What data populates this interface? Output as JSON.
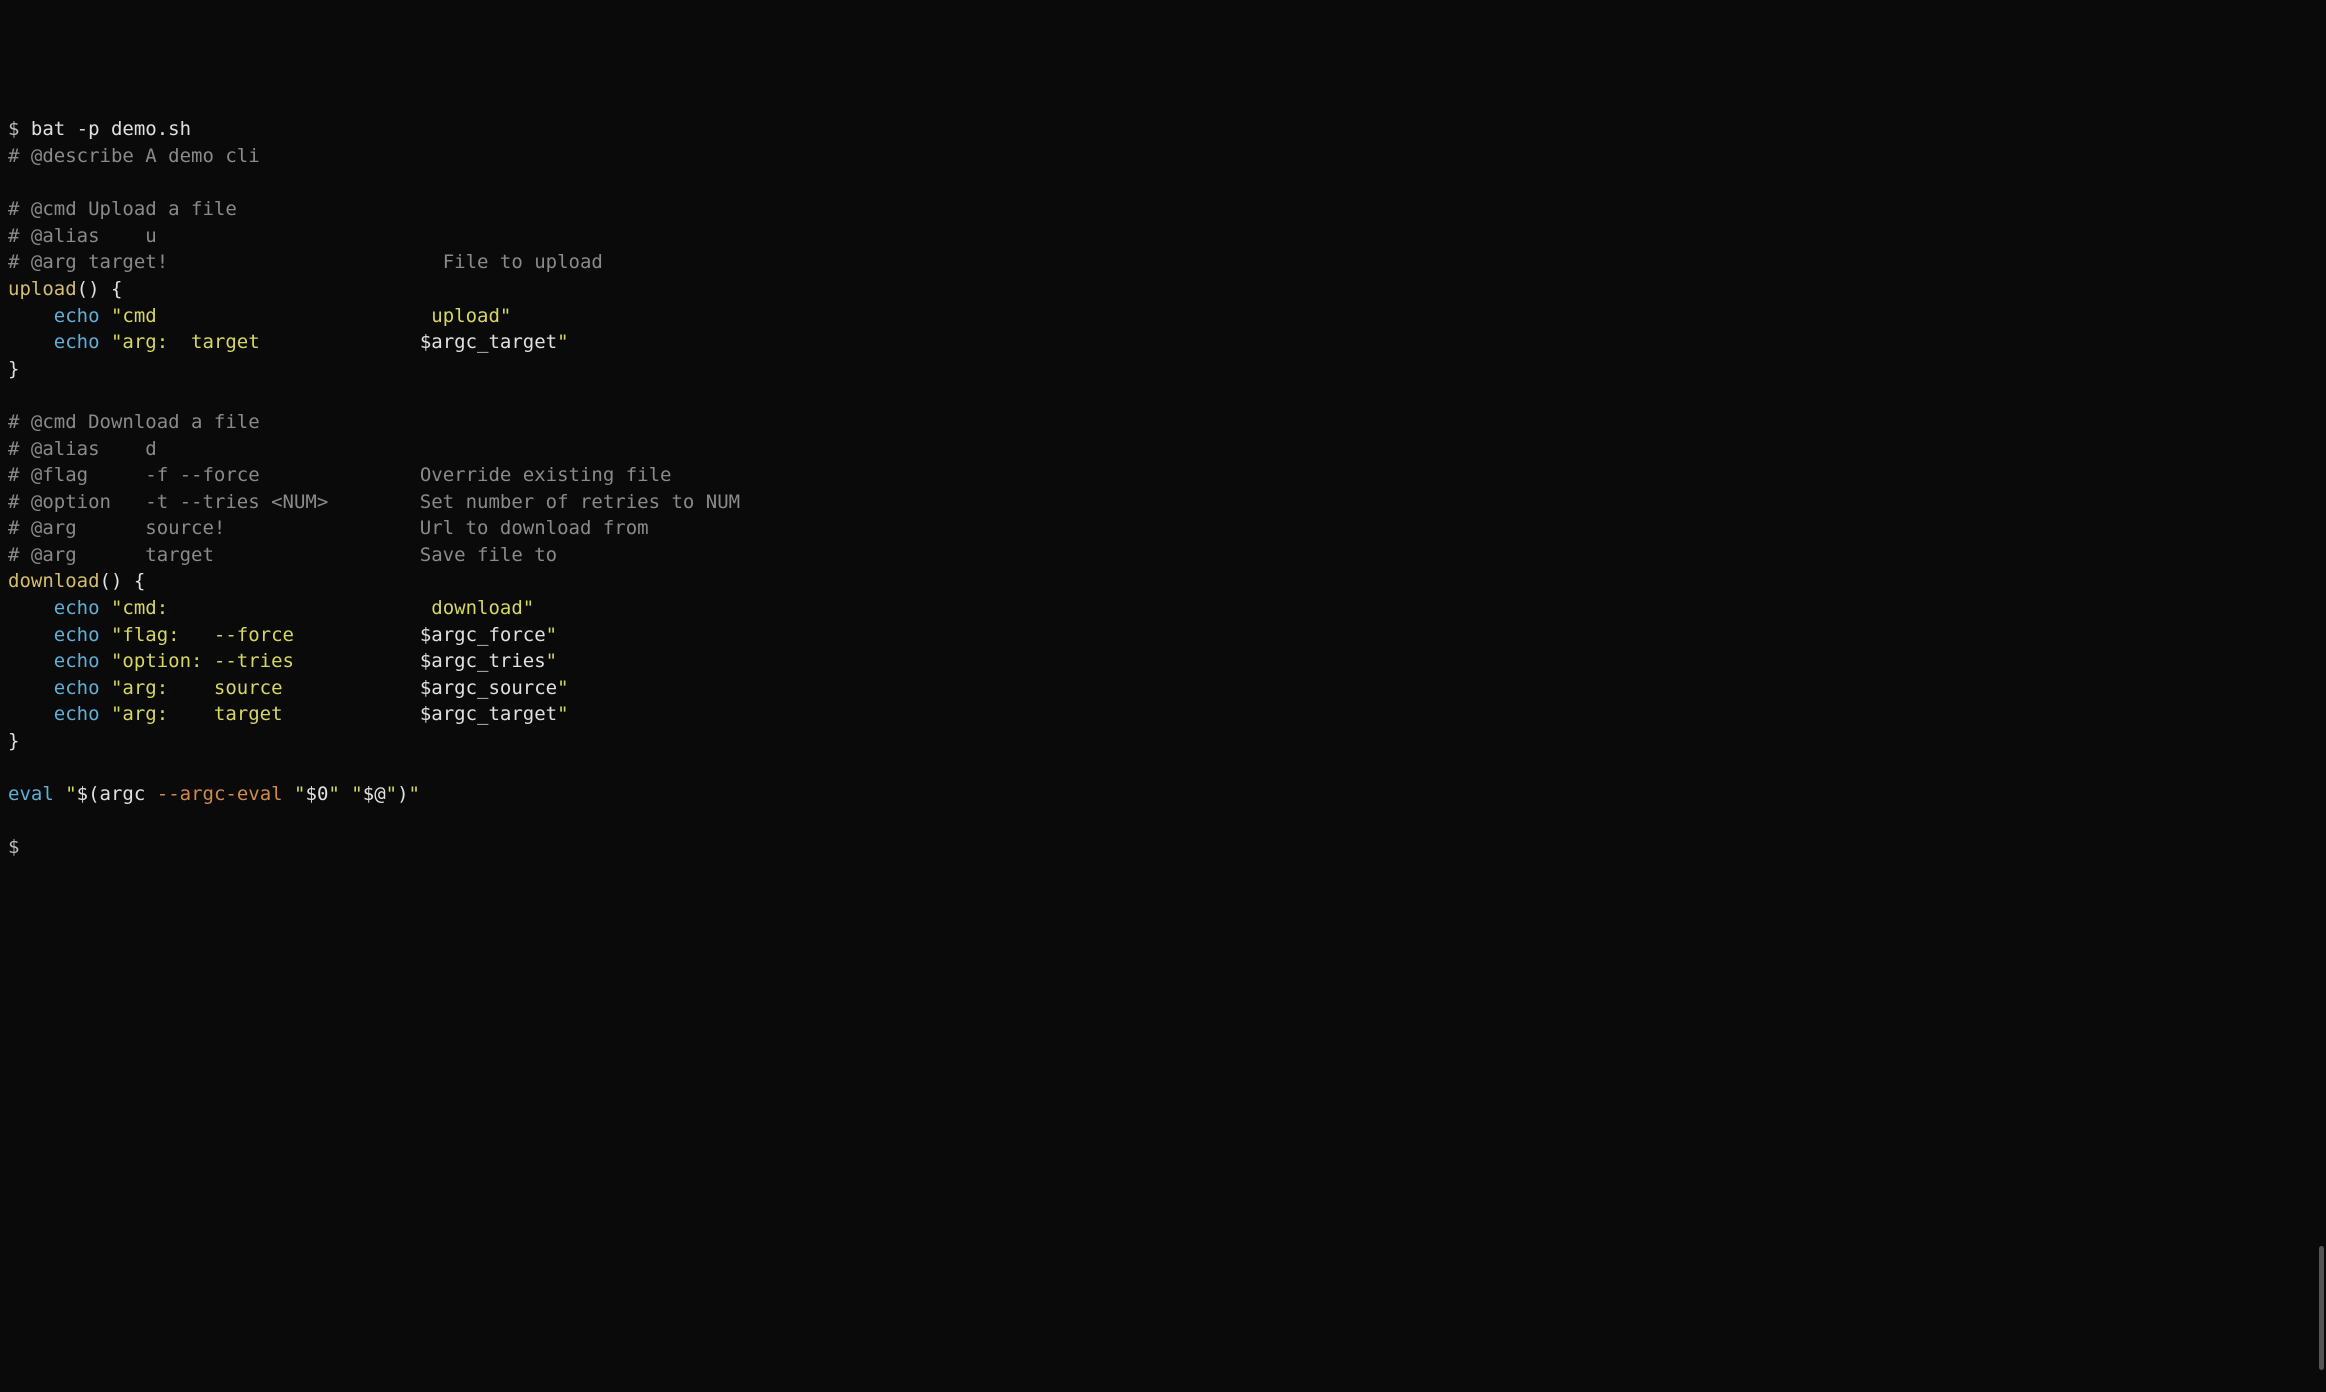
{
  "terminal": {
    "prompt1_symbol": "$ ",
    "prompt1_command": "bat -p demo.sh",
    "prompt2_symbol": "$",
    "file_content": {
      "comment_describe": "# @describe A demo cli",
      "comment_cmd_upload": "# @cmd Upload a file",
      "comment_alias_u": "# @alias    u",
      "comment_arg_target_upload_prefix": "# @arg target!",
      "comment_arg_target_upload_desc": "                        File to upload",
      "upload_func_name": "upload",
      "upload_paren": "()",
      "upload_open_brace": " {",
      "echo_kw": "echo",
      "upload_echo1_str": " \"cmd                        upload\"",
      "upload_echo2_str_part1": " \"arg:  target              ",
      "upload_echo2_var": "$argc_target",
      "upload_echo2_str_part2": "\"",
      "close_brace": "}",
      "comment_cmd_download": "# @cmd Download a file",
      "comment_alias_d": "# @alias    d",
      "comment_flag_force_prefix": "# @flag     -f --force",
      "comment_flag_force_desc": "              Override existing file",
      "comment_option_tries_prefix": "# @option   -t --tries <NUM>",
      "comment_option_tries_desc": "        Set number of retries to NUM",
      "comment_arg_source_prefix": "# @arg      source!",
      "comment_arg_source_desc": "                 Url to download from",
      "comment_arg_target_download_prefix": "# @arg      target",
      "comment_arg_target_download_desc": "                  Save file to",
      "download_func_name": "download",
      "download_paren": "()",
      "download_open_brace": " {",
      "download_echo1_str": " \"cmd:                       download\"",
      "download_echo2_str_part1": " \"flag:   --force           ",
      "download_echo2_var": "$argc_force",
      "download_echo2_str_part2": "\"",
      "download_echo3_str_part1": " \"option: --tries           ",
      "download_echo3_var": "$argc_tries",
      "download_echo3_str_part2": "\"",
      "download_echo4_str_part1": " \"arg:    source            ",
      "download_echo4_var": "$argc_source",
      "download_echo4_str_part2": "\"",
      "download_echo5_str_part1": " \"arg:    target            ",
      "download_echo5_var": "$argc_target",
      "download_echo5_str_part2": "\"",
      "eval_kw": "eval",
      "eval_quote1": " \"",
      "eval_dollar_open": "$(",
      "eval_argc": "argc ",
      "eval_flag": "--argc-eval",
      "eval_space1": " ",
      "eval_q1": "\"",
      "eval_arg0": "$0",
      "eval_q2": "\"",
      "eval_space2": " ",
      "eval_q3": "\"",
      "eval_argAt": "$@",
      "eval_q4": "\"",
      "eval_close_paren": ")",
      "eval_quote2": "\"",
      "indent": "    "
    }
  }
}
